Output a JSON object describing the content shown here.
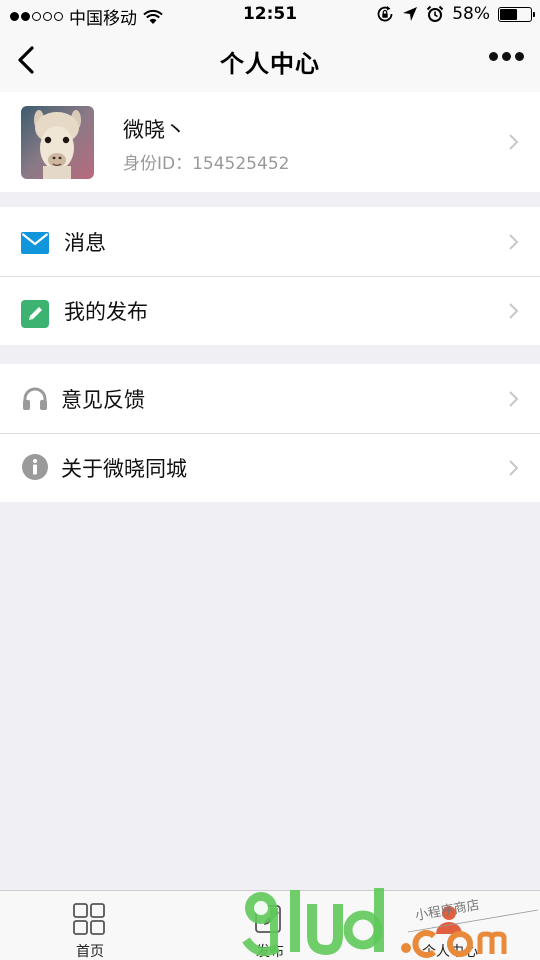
{
  "status_bar": {
    "carrier": "中国移动",
    "time": "12:51",
    "battery_percent": "58%",
    "battery_level": 0.58,
    "signal_bars_filled": 2,
    "signal_bars_total": 5,
    "icons": [
      "wifi-icon",
      "rotation-lock-icon",
      "location-icon",
      "alarm-icon",
      "battery-icon"
    ]
  },
  "nav": {
    "title": "个人中心",
    "back_icon": "chevron-left-icon",
    "more_icon": "more-dots-icon"
  },
  "profile": {
    "name": "微晓丶",
    "id_text": "身份ID：154525452",
    "avatar": "alpaca-avatar"
  },
  "menu_group_1": [
    {
      "label": "消息",
      "icon": "mail-icon",
      "color": "#1296db"
    },
    {
      "label": "我的发布",
      "icon": "edit-icon",
      "color": "#3cb371"
    }
  ],
  "menu_group_2": [
    {
      "label": "意见反馈",
      "icon": "headphones-icon",
      "color": "#9a9a9a"
    },
    {
      "label": "关于微晓同城",
      "icon": "info-icon",
      "color": "#9a9a9a"
    }
  ],
  "tab_bar": {
    "tabs": [
      {
        "label": "首页",
        "icon": "grid-icon"
      },
      {
        "label": "发布",
        "icon": "edit-icon"
      },
      {
        "label": "个人中心",
        "icon": "person-icon"
      }
    ]
  },
  "watermark": {
    "logo_text": "91ud.com",
    "tagline": "小程序商店"
  },
  "colors": {
    "background": "#efeff4",
    "card": "#ffffff",
    "bar": "#f8f8f8",
    "secondary_text": "#999999",
    "chevron": "#c7c7cc"
  }
}
